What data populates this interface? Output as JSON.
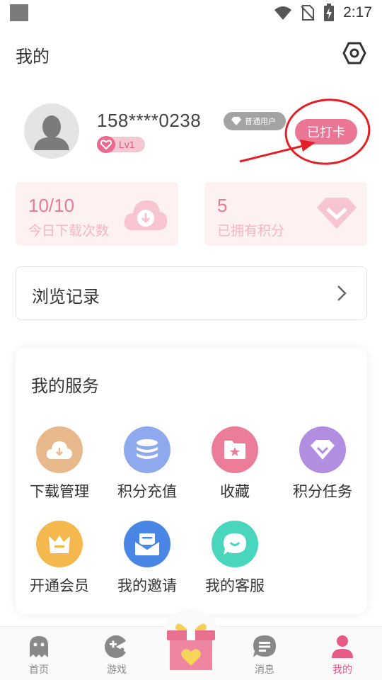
{
  "status_bar": {
    "time": "2:17"
  },
  "header": {
    "title": "我的"
  },
  "profile": {
    "phone": "158****0238",
    "user_type": "普通用户",
    "level": "Lv1",
    "checkin_label": "已打卡"
  },
  "stats": {
    "downloads": {
      "value": "10/10",
      "label": "今日下载次数"
    },
    "points": {
      "value": "5",
      "label": "已拥有积分"
    }
  },
  "history": {
    "label": "浏览记录"
  },
  "services": {
    "title": "我的服务",
    "items": [
      {
        "label": "下载管理",
        "icon": "cloud-download-icon",
        "color": "#e7b98c"
      },
      {
        "label": "积分充值",
        "icon": "coin-stack-icon",
        "color": "#8fa9ee"
      },
      {
        "label": "收藏",
        "icon": "folder-star-icon",
        "color": "#ec7d98"
      },
      {
        "label": "积分任务",
        "icon": "diamond-icon",
        "color": "#b18ee0"
      },
      {
        "label": "开通会员",
        "icon": "crown-icon",
        "color": "#f5b84e"
      },
      {
        "label": "我的邀请",
        "icon": "envelope-icon",
        "color": "#4a86e6"
      },
      {
        "label": "我的客服",
        "icon": "chat-bubble-icon",
        "color": "#4ad6bd"
      }
    ]
  },
  "bottom_nav": {
    "items": [
      {
        "label": "首页",
        "icon": "ghost-icon"
      },
      {
        "label": "游戏",
        "icon": "gamepad-icon"
      },
      {
        "label": "消息",
        "icon": "message-icon"
      },
      {
        "label": "我的",
        "icon": "person-icon",
        "active": true
      }
    ],
    "center_icon": "gift-box-icon"
  },
  "colors": {
    "accent_pink": "#ea7594",
    "stat_card_bg": "#fdf1f1",
    "annotation_red": "#e21f26"
  }
}
